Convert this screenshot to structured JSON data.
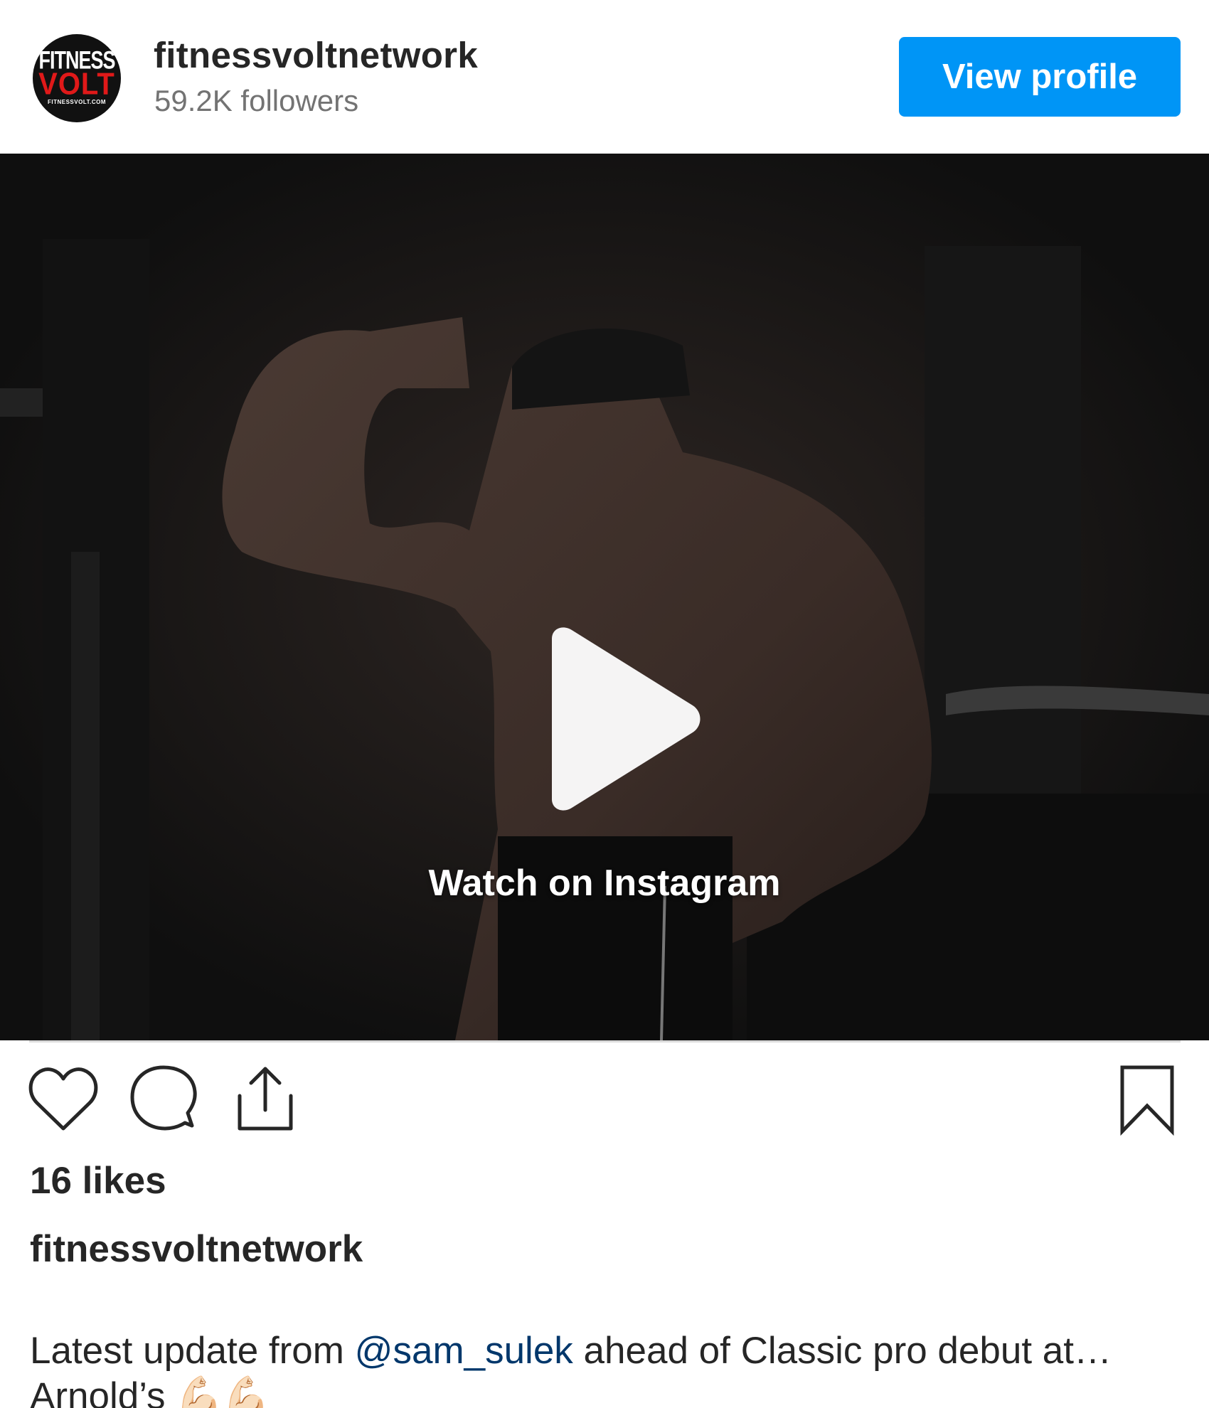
{
  "header": {
    "username": "fitnessvoltnetwork",
    "followers": "59.2K followers",
    "view_profile_label": "View profile",
    "avatar": {
      "line1": "FITNESS",
      "line2": "VOLT",
      "line3": "FITNESSVOLT.COM"
    }
  },
  "media": {
    "watch_label": "Watch on Instagram"
  },
  "actions": {
    "icons": [
      "heart-icon",
      "comment-icon",
      "share-icon",
      "bookmark-icon"
    ]
  },
  "post": {
    "likes": "16 likes",
    "caption_user": "fitnessvoltnetwork",
    "caption_prefix": "Latest update from ",
    "caption_mention": "@sam_sulek",
    "caption_suffix": " ahead of Classic pro debut at…",
    "caption_line2": "Arnold’s 💪🏻💪🏻"
  },
  "colors": {
    "accent": "#0095f6",
    "mention": "#00376b",
    "text": "#262626",
    "secondary_text": "#737373"
  }
}
